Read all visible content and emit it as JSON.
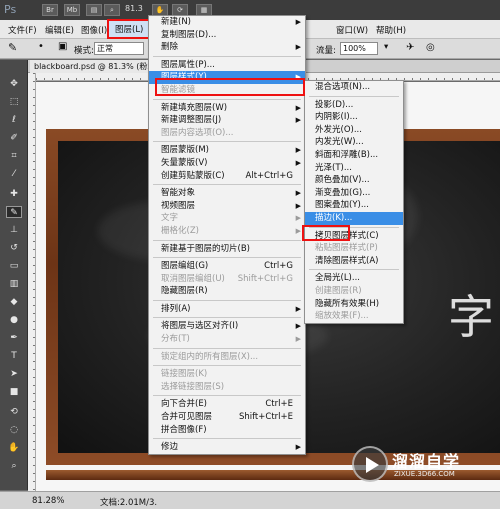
{
  "app": {
    "logo": "Ps",
    "toolbar_buttons": [
      "Br",
      "Mb"
    ],
    "zoom_value": "81.3"
  },
  "menubar": [
    {
      "name": "file",
      "label": "文件(F)"
    },
    {
      "name": "edit",
      "label": "编辑(E)"
    },
    {
      "name": "image",
      "label": "图像(I)"
    },
    {
      "name": "layer",
      "label": "图层(L)"
    },
    {
      "name": "window",
      "label": "窗口(W)"
    },
    {
      "name": "help",
      "label": "帮助(H)"
    }
  ],
  "options": {
    "mode_label": "模式:",
    "mode_value": "正常",
    "flow_label": "流量:",
    "flow_value": "100%"
  },
  "document": {
    "tab_title": "blackboard.psd @ 81.3% (粉笔字..."
  },
  "status": {
    "zoom": "81.28%",
    "doc_info": "文档:2.01M/3."
  },
  "watermark": {
    "title": "溜溜自学",
    "url": "ZIXUE.3D66.COM"
  },
  "layer_menu": {
    "items": [
      {
        "label": "新建(N)",
        "arrow": true
      },
      {
        "label": "复制图层(D)..."
      },
      {
        "label": "删除",
        "arrow": true
      },
      {
        "sep": true
      },
      {
        "label": "图层属性(P)..."
      },
      {
        "label": "图层样式(Y)",
        "arrow": true,
        "highlight": true
      },
      {
        "label": "智能滤镜",
        "disabled": true
      },
      {
        "sep": true
      },
      {
        "label": "新建填充图层(W)",
        "arrow": true
      },
      {
        "label": "新建调整图层(J)",
        "arrow": true
      },
      {
        "label": "图层内容选项(O)...",
        "disabled": true
      },
      {
        "sep": true
      },
      {
        "label": "图层蒙版(M)",
        "arrow": true
      },
      {
        "label": "矢量蒙版(V)",
        "arrow": true
      },
      {
        "label": "创建剪贴蒙版(C)",
        "shortcut": "Alt+Ctrl+G"
      },
      {
        "sep": true
      },
      {
        "label": "智能对象",
        "arrow": true
      },
      {
        "label": "视频图层",
        "arrow": true
      },
      {
        "label": "文字",
        "arrow": true,
        "disabled": true
      },
      {
        "label": "栅格化(Z)",
        "arrow": true,
        "disabled": true
      },
      {
        "sep": true
      },
      {
        "label": "新建基于图层的切片(B)"
      },
      {
        "sep": true
      },
      {
        "label": "图层编组(G)",
        "shortcut": "Ctrl+G"
      },
      {
        "label": "取消图层编组(U)",
        "shortcut": "Shift+Ctrl+G",
        "disabled": true
      },
      {
        "label": "隐藏图层(R)"
      },
      {
        "sep": true
      },
      {
        "label": "排列(A)",
        "arrow": true
      },
      {
        "sep": true
      },
      {
        "label": "将图层与选区对齐(I)",
        "arrow": true
      },
      {
        "label": "分布(T)",
        "arrow": true,
        "disabled": true
      },
      {
        "sep": true
      },
      {
        "label": "锁定组内的所有图层(X)...",
        "disabled": true
      },
      {
        "sep": true
      },
      {
        "label": "链接图层(K)",
        "disabled": true
      },
      {
        "label": "选择链接图层(S)",
        "disabled": true
      },
      {
        "sep": true
      },
      {
        "label": "向下合并(E)",
        "shortcut": "Ctrl+E"
      },
      {
        "label": "合并可见图层",
        "shortcut": "Shift+Ctrl+E"
      },
      {
        "label": "拼合图像(F)"
      },
      {
        "sep": true
      },
      {
        "label": "修边",
        "arrow": true
      }
    ]
  },
  "style_menu": {
    "items": [
      {
        "label": "混合选项(N)..."
      },
      {
        "sep": true
      },
      {
        "label": "投影(D)..."
      },
      {
        "label": "内阴影(I)..."
      },
      {
        "label": "外发光(O)..."
      },
      {
        "label": "内发光(W)..."
      },
      {
        "label": "斜面和浮雕(B)..."
      },
      {
        "label": "光泽(T)..."
      },
      {
        "label": "颜色叠加(V)..."
      },
      {
        "label": "渐变叠加(G)..."
      },
      {
        "label": "图案叠加(Y)..."
      },
      {
        "label": "描边(K)...",
        "highlight": true
      },
      {
        "sep": true
      },
      {
        "label": "拷贝图层样式(C)"
      },
      {
        "label": "粘贴图层样式(P)",
        "disabled": true
      },
      {
        "label": "清除图层样式(A)"
      },
      {
        "sep": true
      },
      {
        "label": "全局光(L)..."
      },
      {
        "label": "创建图层(R)",
        "disabled": true
      },
      {
        "label": "隐藏所有效果(H)"
      },
      {
        "label": "缩放效果(F)...",
        "disabled": true
      }
    ]
  },
  "chalk_text": "字"
}
